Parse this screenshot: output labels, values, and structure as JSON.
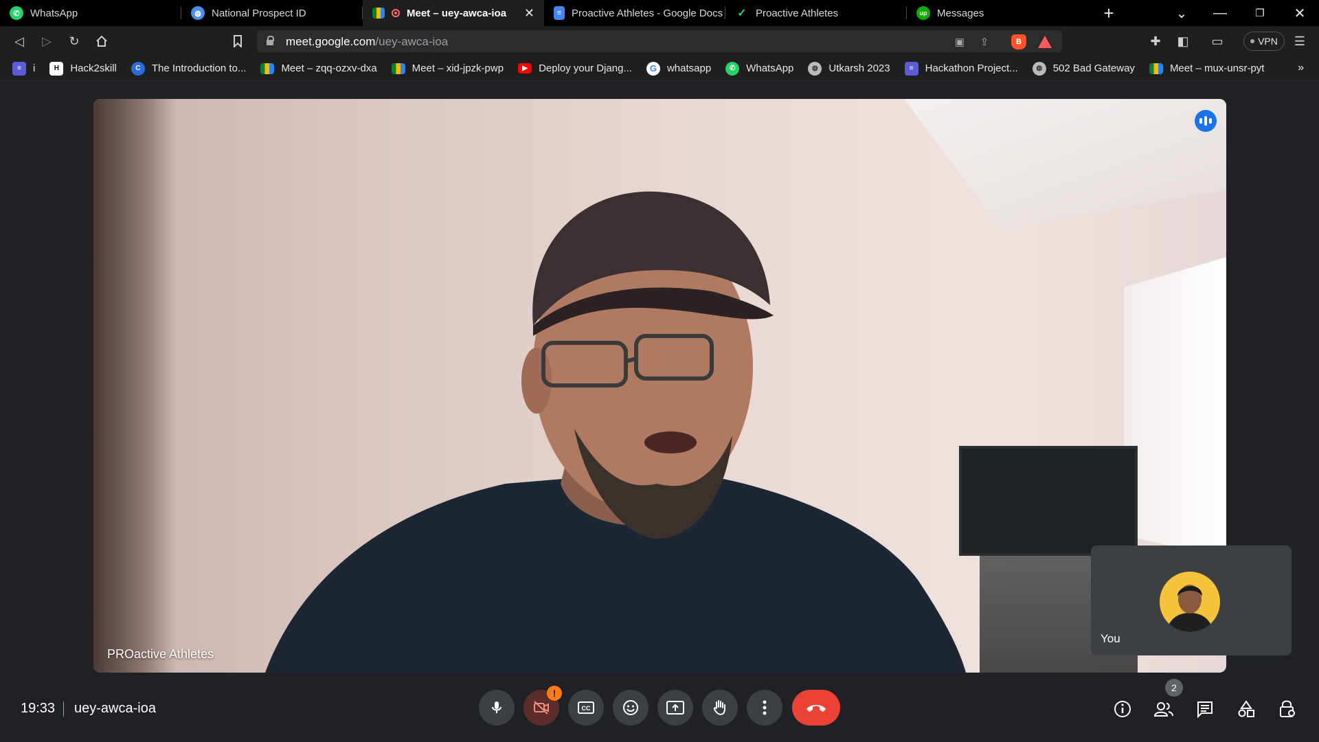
{
  "browser": {
    "tabs": [
      {
        "title": "WhatsApp",
        "icon": "whatsapp-icon",
        "active": false
      },
      {
        "title": "National Prospect ID",
        "icon": "globe-icon",
        "active": false
      },
      {
        "title": "Meet – uey-awca-ioa",
        "icon": "google-meet-icon",
        "active": true
      },
      {
        "title": "Proactive Athletes - Google Docs",
        "icon": "google-docs-icon",
        "active": false
      },
      {
        "title": "Proactive Athletes",
        "icon": "check-logo-icon",
        "active": false
      },
      {
        "title": "Messages",
        "icon": "upwork-icon",
        "active": false
      }
    ],
    "new_tab_label": "+",
    "url_host": "meet.google.com",
    "url_path": "/uey-awca-ioa",
    "vpn_label": "VPN",
    "bookmarks": [
      {
        "label": "i",
        "icon": "list-icon"
      },
      {
        "label": "Hack2skill",
        "icon": "hack2skill-icon"
      },
      {
        "label": "The Introduction to...",
        "icon": "c-logo-icon"
      },
      {
        "label": "Meet – zqq-ozxv-dxa",
        "icon": "google-meet-icon"
      },
      {
        "label": "Meet – xid-jpzk-pwp",
        "icon": "google-meet-icon"
      },
      {
        "label": "Deploy your Djang...",
        "icon": "youtube-icon"
      },
      {
        "label": "whatsapp",
        "icon": "google-icon"
      },
      {
        "label": "WhatsApp",
        "icon": "whatsapp-icon"
      },
      {
        "label": "Utkarsh 2023",
        "icon": "globe-icon"
      },
      {
        "label": "Hackathon Project...",
        "icon": "list-icon"
      },
      {
        "label": "502 Bad Gateway",
        "icon": "globe-icon"
      },
      {
        "label": "Meet – mux-unsr-pyt",
        "icon": "google-meet-icon"
      }
    ],
    "bookmarks_more": "»"
  },
  "meet": {
    "speaker_name": "PROactive Athletes",
    "self_name": "You",
    "clock": "19:33",
    "meeting_code": "uey-awca-ioa",
    "camera_alert": "!",
    "participants_count": "2",
    "controls": [
      "microphone",
      "camera-off",
      "captions",
      "emoji",
      "present",
      "raise-hand",
      "more-options",
      "leave-call"
    ],
    "right_controls": [
      "meeting-details",
      "people",
      "chat",
      "activities",
      "host-controls"
    ]
  },
  "colors": {
    "meet_background": "#202124",
    "control_button": "#3c4043",
    "end_call": "#ea4335",
    "speaking_indicator": "#1a73e8",
    "alert": "#fa7b17"
  }
}
